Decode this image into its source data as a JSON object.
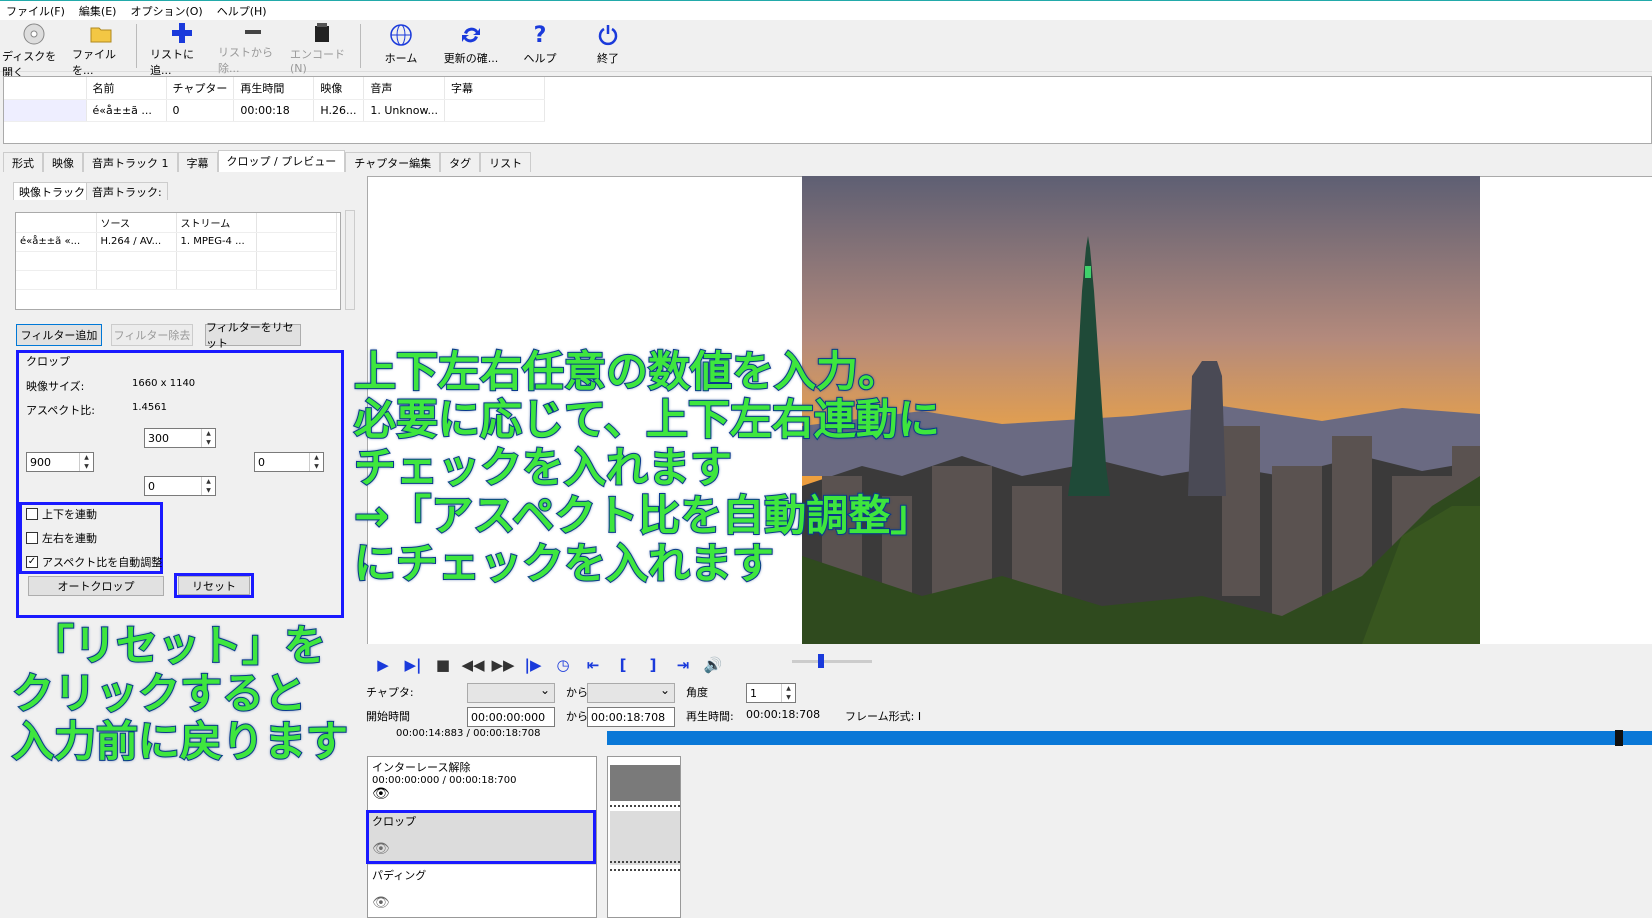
{
  "menu": [
    "ファイル(F)",
    "編集(E)",
    "オプション(O)",
    "ヘルプ(H)"
  ],
  "toolbar": {
    "open_disc": "ディスクを開く",
    "open_file": "ファイルを...",
    "add_list": "リストに追...",
    "remove_list": "リストから除...",
    "encode": "エンコード(N)",
    "home": "ホーム",
    "update": "更新の確...",
    "help": "ヘルプ",
    "exit": "終了"
  },
  "filelist": {
    "headers": [
      "名前",
      "チャプター",
      "再生時間",
      "映像",
      "音声",
      "字幕"
    ],
    "row": [
      "é«å±±ã ...",
      "0",
      "00:00:18",
      "H.26...",
      "1. Unknow...",
      ""
    ]
  },
  "tabs": [
    "形式",
    "映像",
    "音声トラック 1",
    "字幕",
    "クロップ / プレビュー",
    "チャプター編集",
    "タグ",
    "リスト"
  ],
  "subtabs": [
    "映像トラック:",
    "音声トラック:"
  ],
  "tracklist": {
    "headers": [
      "",
      "ソース",
      "ストリーム"
    ],
    "row": [
      "é«å±±ã «...",
      "H.264 / AV...",
      "1. MPEG-4 ..."
    ]
  },
  "filter_buttons": {
    "add": "フィルター追加",
    "remove": "フィルター除去",
    "reset": "フィルターをリセット"
  },
  "crop": {
    "group_title": "クロップ",
    "video_size_label": "映像サイズ:",
    "video_size": "1660 x 1140",
    "aspect_label": "アスペクト比:",
    "aspect": "1.4561",
    "top": "300",
    "left": "900",
    "right": "0",
    "bottom": "0",
    "link_tb": "上下を連動",
    "link_lr": "左右を連動",
    "auto_aspect": "アスペクト比を自動調整",
    "autocrop": "オートクロップ",
    "reset": "リセット"
  },
  "player": {
    "chapter_label": "チャプタ:",
    "from_label": "から",
    "angle_label": "角度",
    "angle": "1",
    "start_label": "開始時間",
    "start": "00:00:00:000",
    "end": "00:00:18:708",
    "duration_label": "再生時間:",
    "duration": "00:00:18:708",
    "frame_label": "フレーム形式: I",
    "position": "00:00:14:883 / 00:00:18:708"
  },
  "filters": [
    {
      "name": "インターレース解除",
      "time": "00:00:00:000 / 00:00:18:700"
    },
    {
      "name": "クロップ",
      "time": ""
    },
    {
      "name": "パディング",
      "time": ""
    }
  ],
  "annotations": {
    "main_1": "上下左右任意の数値を入力。",
    "main_2": "必要に応じて、上下左右連動に",
    "main_3": "チェックを入れます",
    "main_4": "→「アスペクト比を自動調整」",
    "main_5": "にチェックを入れます",
    "reset_1": "「リセット」を",
    "reset_2": "クリックすると",
    "reset_3": "入力前に戻ります"
  },
  "colors": {
    "annotation_text": "#3ee63e",
    "annotation_outline": "#0a3a8a",
    "highlight_box": "#1a1aff",
    "timeline": "#0a78d7"
  }
}
